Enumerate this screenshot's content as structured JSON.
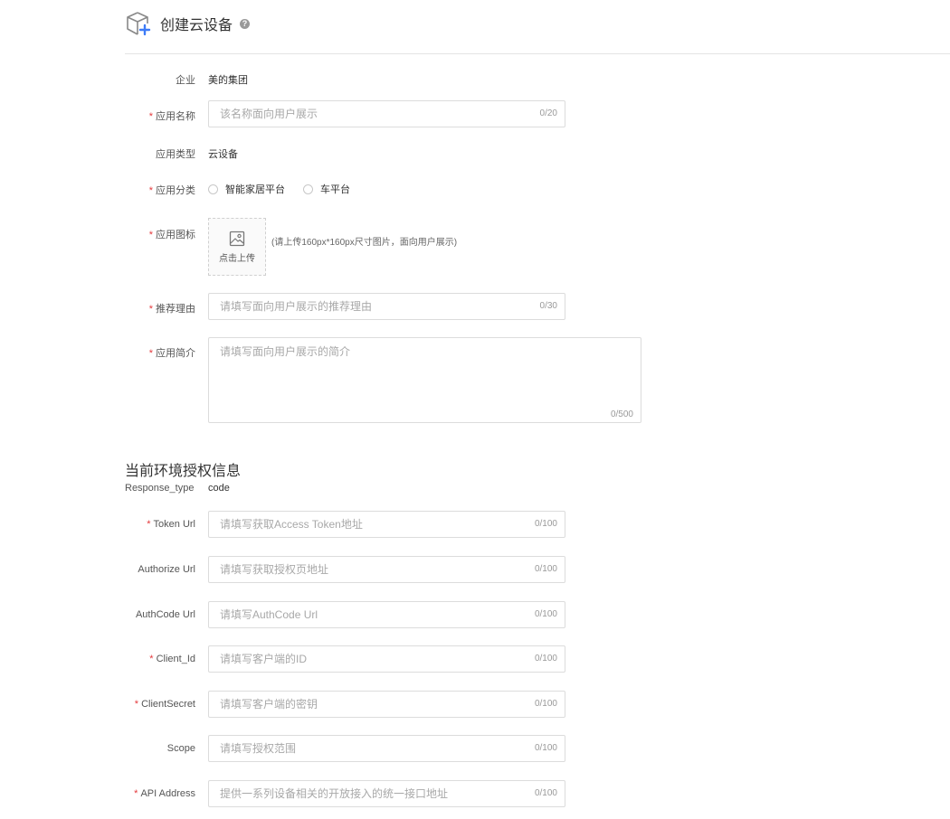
{
  "header": {
    "title": "创建云设备",
    "help_icon": "question-circle-icon",
    "cube_icon": "cube-add-icon",
    "accent": "#3d7bf7"
  },
  "fields": {
    "enterprise": {
      "label": "企业",
      "value": "美的集团"
    },
    "app_name": {
      "label": "应用名称",
      "placeholder": "该名称面向用户展示",
      "count": "0/20"
    },
    "app_type": {
      "label": "应用类型",
      "value": "云设备"
    },
    "app_category": {
      "label": "应用分类",
      "options": [
        "智能家居平台",
        "车平台"
      ]
    },
    "app_icon": {
      "label": "应用图标",
      "upload_text": "点击上传",
      "hint": "(请上传160px*160px尺寸图片，面向用户展示)",
      "icon": "image-icon"
    },
    "reason": {
      "label": "推荐理由",
      "placeholder": "请填写面向用户展示的推荐理由",
      "count": "0/30"
    },
    "intro": {
      "label": "应用简介",
      "placeholder": "请填写面向用户展示的简介",
      "count": "0/500"
    }
  },
  "auth": {
    "section_title": "当前环境授权信息",
    "response_type": {
      "label": "Response_type",
      "value": "code"
    },
    "token_url": {
      "label": "Token Url",
      "placeholder": "请填写获取Access Token地址",
      "count": "0/100"
    },
    "authorize_url": {
      "label": "Authorize Url",
      "placeholder": "请填写获取授权页地址",
      "count": "0/100"
    },
    "authcode_url": {
      "label": "AuthCode Url",
      "placeholder": "请填写AuthCode Url",
      "count": "0/100"
    },
    "client_id": {
      "label": "Client_Id",
      "placeholder": "请填写客户端的ID",
      "count": "0/100"
    },
    "client_secret": {
      "label": "ClientSecret",
      "placeholder": "请填写客户端的密钥",
      "count": "0/100"
    },
    "scope": {
      "label": "Scope",
      "placeholder": "请填写授权范围",
      "count": "0/100"
    },
    "api_address": {
      "label": "API Address",
      "placeholder": "提供一系列设备相关的开放接入的统一接口地址",
      "count": "0/100"
    }
  },
  "required_mark": "*"
}
